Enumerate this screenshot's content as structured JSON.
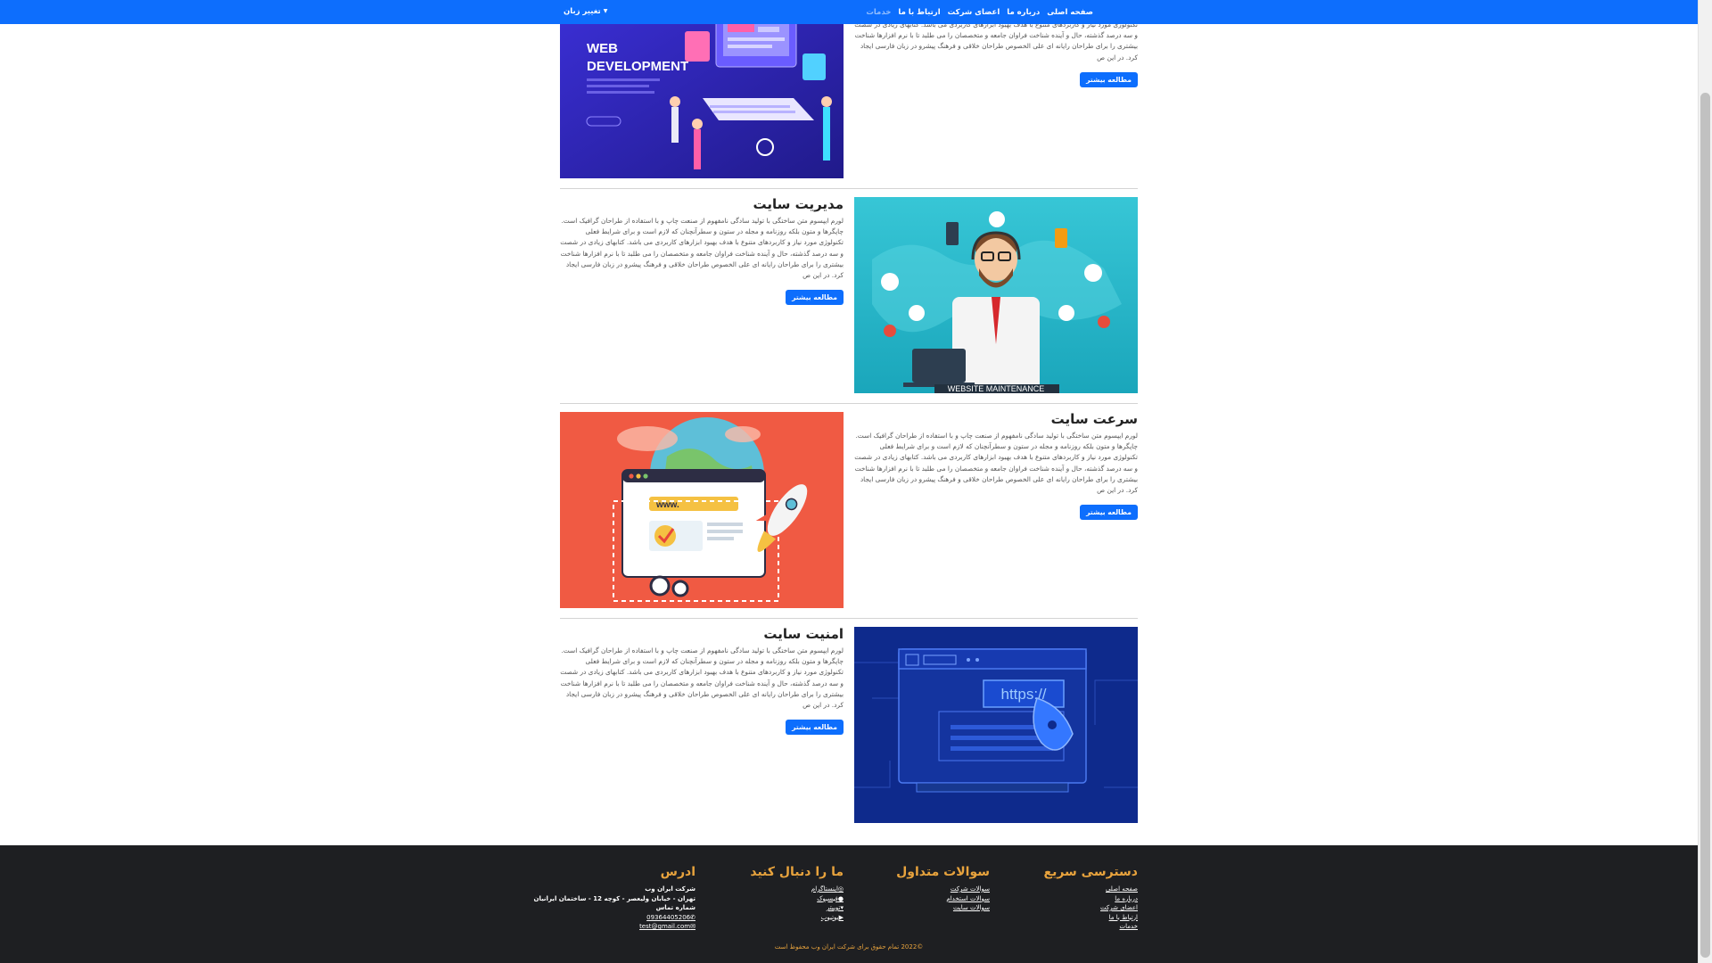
{
  "nav": {
    "items": [
      {
        "label": "صفحه اصلی"
      },
      {
        "label": "درباره ما"
      },
      {
        "label": "اعضای شرکت"
      },
      {
        "label": "ارتباط با ما"
      },
      {
        "label": "خدمات"
      }
    ],
    "active": "خدمات",
    "language": "تغییر زبان"
  },
  "services": [
    {
      "title": "",
      "desc": "تکنولوژی مورد نیاز و کاربردهای متنوع با هدف بهبود ابزارهای کاربردی می باشد. کتابهای زیادی در شصت و سه درصد گذشته، حال و آینده شناخت فراوان جامعه و متخصصان را می طلبد تا با نرم افزارها شناخت بیشتری را برای طراحان رایانه ای علی الخصوص طراحان خلاقی و فرهنگ پیشرو در زبان فارسی ایجاد کرد. در این ص",
      "button": "مطالعه بیشتر",
      "image_caption_line1": "WEB",
      "image_caption_line2": "DEVELOPMENT"
    },
    {
      "title": "مدیریت سایت",
      "desc": "لورم ایپسوم متن ساختگی با تولید سادگی نامفهوم از صنعت چاپ و با استفاده از طراحان گرافیک است. چاپگرها و متون بلکه روزنامه و مجله در ستون و سطرآنچنان که لازم است و برای شرایط فعلی تکنولوژی مورد نیاز و کاربردهای متنوع با هدف بهبود ابزارهای کاربردی می باشد. کتابهای زیادی در شصت و سه درصد گذشته، حال و آینده شناخت فراوان جامعه و متخصصان را می طلبد تا با نرم افزارها شناخت بیشتری را برای طراحان رایانه ای علی الخصوص طراحان خلاقی و فرهنگ پیشرو در زبان فارسی ایجاد کرد. در این ص",
      "button": "مطالعه بیشتر",
      "image_caption": "WEBSITE MAINTENANCE"
    },
    {
      "title": "سرعت سایت",
      "desc": "لورم ایپسوم متن ساختگی با تولید سادگی نامفهوم از صنعت چاپ و با استفاده از طراحان گرافیک است. چاپگرها و متون بلکه روزنامه و مجله در ستون و سطرآنچنان که لازم است و برای شرایط فعلی تکنولوژی مورد نیاز و کاربردهای متنوع با هدف بهبود ابزارهای کاربردی می باشد. کتابهای زیادی در شصت و سه درصد گذشته، حال و آینده شناخت فراوان جامعه و متخصصان را می طلبد تا با نرم افزارها شناخت بیشتری را برای طراحان رایانه ای علی الخصوص طراحان خلاقی و فرهنگ پیشرو در زبان فارسی ایجاد کرد. در این ص",
      "button": "مطالعه بیشتر",
      "image_caption": "www."
    },
    {
      "title": "امنیت سایت",
      "desc": "لورم ایپسوم متن ساختگی با تولید سادگی نامفهوم از صنعت چاپ و با استفاده از طراحان گرافیک است. چاپگرها و متون بلکه روزنامه و مجله در ستون و سطرآنچنان که لازم است و برای شرایط فعلی تکنولوژی مورد نیاز و کاربردهای متنوع با هدف بهبود ابزارهای کاربردی می باشد. کتابهای زیادی در شصت و سه درصد گذشته، حال و آینده شناخت فراوان جامعه و متخصصان را می طلبد تا با نرم افزارها شناخت بیشتری را برای طراحان رایانه ای علی الخصوص طراحان خلاقی و فرهنگ پیشرو در زبان فارسی ایجاد کرد. در این ص",
      "button": "مطالعه بیشتر",
      "image_caption": "https://"
    }
  ],
  "footer": {
    "quick": {
      "title": "دسترسی سریع",
      "links": [
        "صفحه اصلی",
        "درباره ما",
        "اعضای شرکت",
        "ارتباط با ما",
        "خدمات"
      ]
    },
    "faq": {
      "title": "سوالات متداول",
      "links": [
        "سوالات شرکت",
        "سوالات استخدام",
        "سوالات سایت"
      ]
    },
    "follow": {
      "title": "ما را دنبال کنید",
      "links": [
        "اینستاگرام",
        "فیسبوک",
        "توییتر",
        "یوتیوب"
      ]
    },
    "address": {
      "title": "ادرس",
      "company": "شرکت ایران وب",
      "street": "تهران - خیابان ولیعصر - کوچه 12 - ساختمان ایرانیان",
      "phone_label": "شماره تماس",
      "phone": "09364405206",
      "email": "test@gmail.com"
    },
    "copyright": "©2022 تمام حقوق برای شرکت ایران وب محفوظ است"
  },
  "colors": {
    "primary": "#0d6efd",
    "footer_bg": "#1e1f22",
    "footer_accent": "#e8a33d"
  }
}
